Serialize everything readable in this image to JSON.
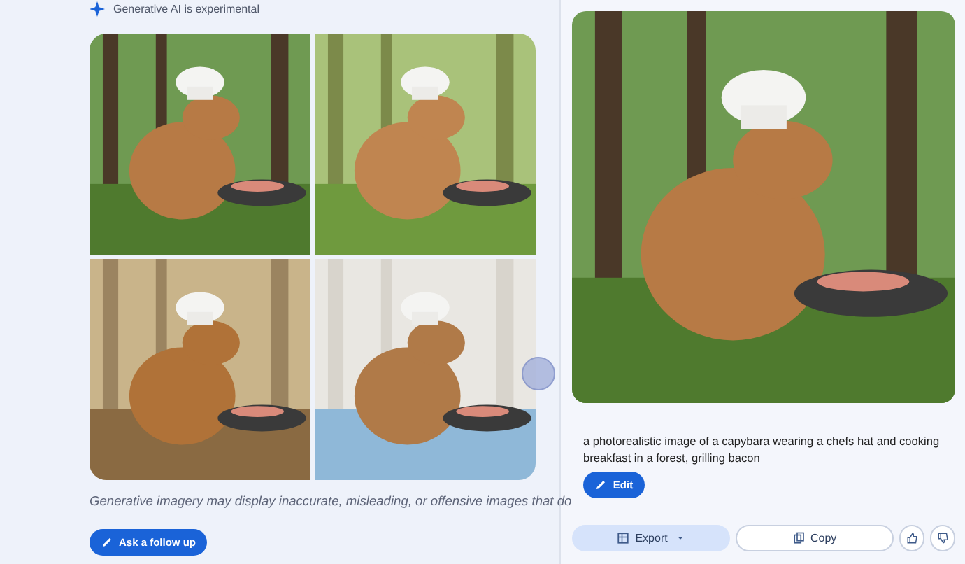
{
  "left": {
    "notice": "Generative AI is experimental",
    "disclaimer": "Generative imagery may display inaccurate, misleading, or offensive images that do",
    "follow_up_button": "Ask a follow up"
  },
  "right": {
    "prompt": "a photorealistic image of a capybara wearing a chefs hat and cooking breakfast in a forest, grilling bacon",
    "edit_button": "Edit",
    "export_button": "Export",
    "copy_button": "Copy"
  }
}
